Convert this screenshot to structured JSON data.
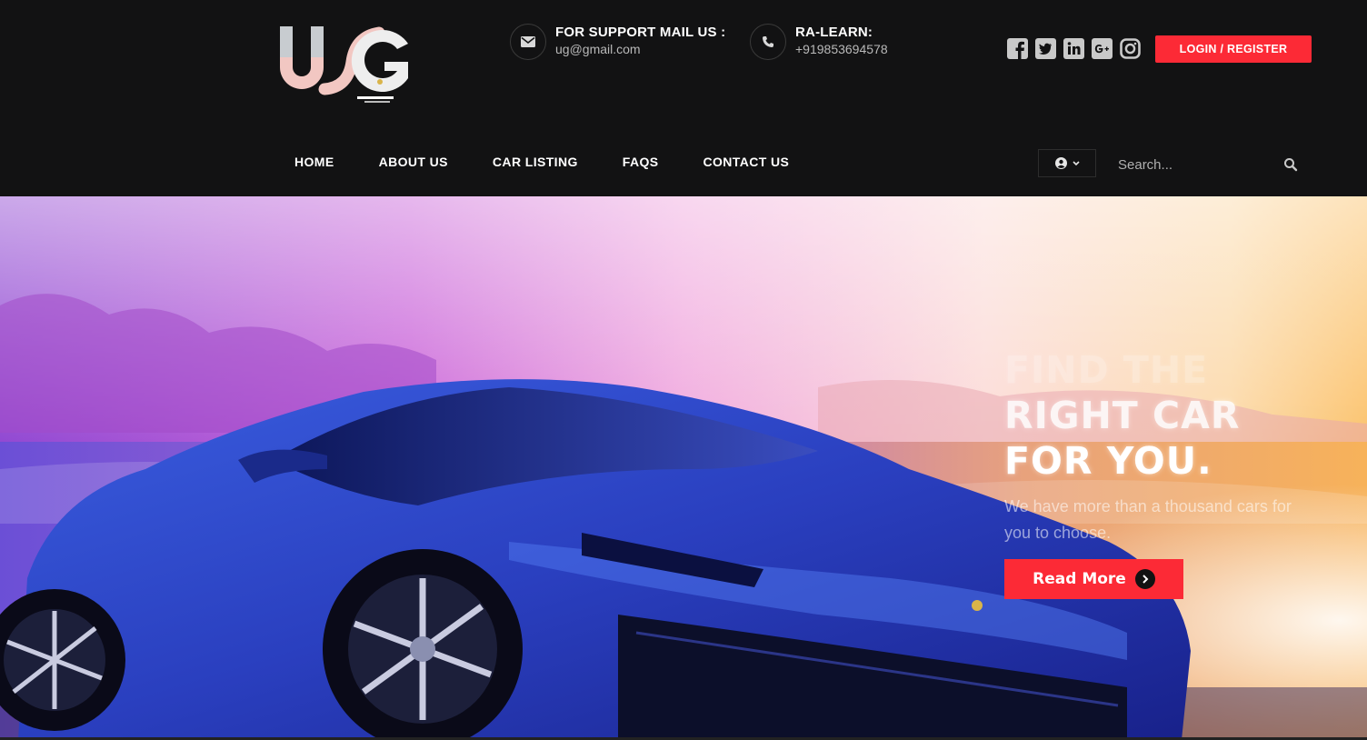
{
  "brand": {
    "logo_icon": "ug-logo",
    "colors": {
      "accent": "#fc2a36",
      "topbar": "#121213"
    }
  },
  "contact": {
    "mail": {
      "icon": "envelope-icon",
      "title": "FOR SUPPORT MAIL US :",
      "value": "ug@gmail.com"
    },
    "phone": {
      "icon": "phone-icon",
      "title": "RA-LEARN:",
      "value": "+919853694578"
    }
  },
  "social": [
    "facebook-icon",
    "twitter-icon",
    "linkedin-icon",
    "google-plus-icon",
    "instagram-icon"
  ],
  "header": {
    "login_label": "LOGIN / REGISTER"
  },
  "nav": {
    "items": [
      {
        "label": "HOME"
      },
      {
        "label": "ABOUT US"
      },
      {
        "label": "CAR LISTING"
      },
      {
        "label": "FAQS"
      },
      {
        "label": "CONTACT US"
      }
    ]
  },
  "search": {
    "placeholder": "Search...",
    "user_icon": "user-circle-icon",
    "search_icon": "search-icon"
  },
  "hero": {
    "headline": [
      "FIND THE",
      "RIGHT CAR",
      "FOR YOU."
    ],
    "subtext": "We have more than a thousand cars for you to choose.",
    "button_label": "Read More"
  }
}
